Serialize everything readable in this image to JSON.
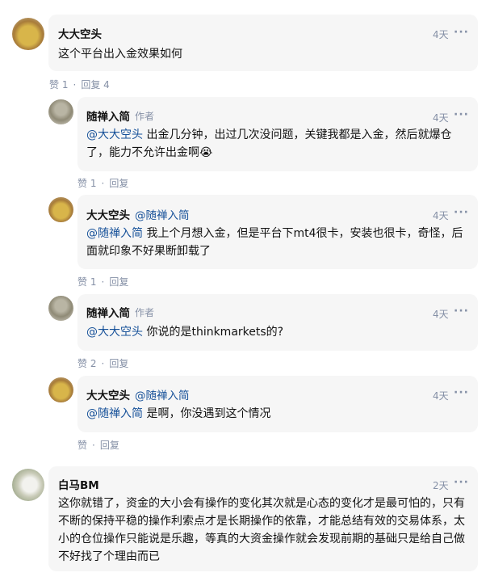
{
  "comments": [
    {
      "author": "大大空头",
      "time": "4天",
      "text": "这个平台出入金效果如何",
      "like_label": "赞",
      "like_count": "1",
      "reply_label": "回复",
      "reply_count": "4"
    },
    {
      "author": "随禅入简",
      "author_tag": "作者",
      "time": "4天",
      "mention": "@大大空头",
      "text": "出金几分钟，出过几次没问题，关键我都是入金，然后就爆仓了，能力不允许出金啊😭",
      "like_label": "赞",
      "like_count": "1",
      "reply_label": "回复"
    },
    {
      "author": "大大空头",
      "reply_to": "@随禅入简",
      "time": "4天",
      "mention": "@随禅入简",
      "text": "我上个月想入金，但是平台下mt4很卡，安装也很卡，奇怪，后面就印象不好果断卸载了",
      "like_label": "赞",
      "like_count": "1",
      "reply_label": "回复"
    },
    {
      "author": "随禅入简",
      "author_tag": "作者",
      "time": "4天",
      "mention": "@大大空头",
      "text": "你说的是thinkmarkets的?",
      "like_label": "赞",
      "like_count": "2",
      "reply_label": "回复"
    },
    {
      "author": "大大空头",
      "reply_to": "@随禅入简",
      "time": "4天",
      "mention": "@随禅入简",
      "text": "是啊，你没遇到这个情况",
      "like_label": "赞",
      "like_count": "",
      "reply_label": "回复"
    },
    {
      "author": "白马BM",
      "time": "2天",
      "text": "这你就错了，资金的大小会有操作的变化其次就是心态的变化才是最可怕的，只有不断的保持平稳的操作利索点才是长期操作的依靠，才能总结有效的交易体系，太小的仓位操作只能说是乐趣，等真的大资金操作就会发现前期的基础只是给自己做不好找了个理由而已"
    }
  ],
  "more_glyph": "···",
  "colors": {
    "link": "#175199",
    "meta": "#8590a6",
    "bubble": "#f6f6f6"
  }
}
